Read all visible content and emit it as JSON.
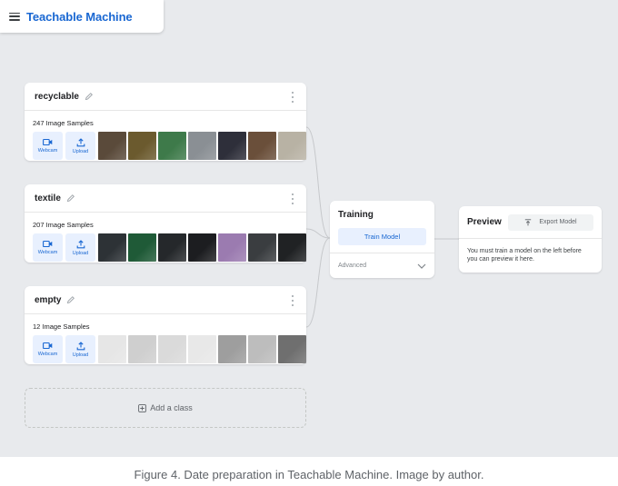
{
  "header": {
    "app_title": "Teachable Machine"
  },
  "classes": [
    {
      "name": "recyclable",
      "samples": "247 Image Samples",
      "webcam": "Webcam",
      "upload": "Upload",
      "thumbs": [
        "#5a4a3a",
        "#6b5a2e",
        "#3e7a4a",
        "#8a8f94",
        "#2e2f3a",
        "#6a4f3a",
        "#b8b2a4"
      ]
    },
    {
      "name": "textile",
      "samples": "207 Image Samples",
      "webcam": "Webcam",
      "upload": "Upload",
      "thumbs": [
        "#2d3236",
        "#1f5a37",
        "#25282b",
        "#1c1d20",
        "#9b7bb0",
        "#3a3d40",
        "#202224"
      ]
    },
    {
      "name": "empty",
      "samples": "12 Image Samples",
      "webcam": "Webcam",
      "upload": "Upload",
      "thumbs": [
        "#e6e6e6",
        "#cfcfcf",
        "#dadada",
        "#e8e8e8",
        "#9e9e9e",
        "#bdbdbd",
        "#6f6f6f"
      ]
    }
  ],
  "add_class": {
    "label": "Add a class"
  },
  "training": {
    "title": "Training",
    "train_button": "Train Model",
    "advanced": "Advanced"
  },
  "preview": {
    "title": "Preview",
    "export_button": "Export Model",
    "message": "You must train a model on the left before you can preview it here."
  },
  "caption": "Figure 4. Date preparation in Teachable Machine. Image by author.",
  "colors": {
    "accent": "#1967d2",
    "accent_bg": "#e8f0fe",
    "canvas_bg": "#e8eaed"
  }
}
